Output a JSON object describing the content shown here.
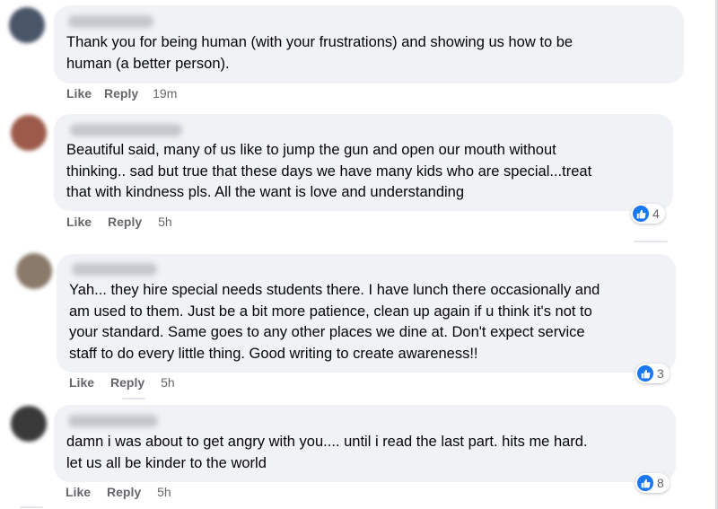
{
  "comments": [
    {
      "author_blurred": true,
      "text": "Thank you for being human (with your frustrations) and showing us how to be\nhuman (a better person).",
      "like_label": "Like",
      "reply_label": "Reply",
      "time": "19m",
      "avatar_color": "#4a5568"
    },
    {
      "author_blurred": true,
      "text": "Beautiful said, many of us like to jump the gun and open our mouth without\nthinking.. sad but true that these days we have many kids who are special...treat\nthat with kindness pls. All the want is love and understanding",
      "like_label": "Like",
      "reply_label": "Reply",
      "time": "5h",
      "reactions": {
        "icon": "like-icon",
        "count": "4"
      },
      "avatar_color": "#9c5a4a"
    },
    {
      "author_blurred": true,
      "text": "Yah... they hire special needs students there. I have lunch there occasionally and\nam used to them. Just be a bit more patience, clean up again if u think it's not to\nyour standard. Same goes to any other places we dine at. Don't expect service\nstaff to do every little thing. Good writing to create awareness!!",
      "like_label": "Like",
      "reply_label": "Reply",
      "time": "5h",
      "reactions": {
        "icon": "like-icon",
        "count": "3"
      },
      "avatar_color": "#8a7a6a"
    },
    {
      "author_blurred": true,
      "text": "damn i was about to get angry with you.... until i read the last part. hits me hard.\nlet us all be kinder to the world",
      "like_label": "Like",
      "reply_label": "Reply",
      "time": "5h",
      "reactions": {
        "icon": "like-icon",
        "count": "8"
      },
      "avatar_color": "#3a3a3a"
    }
  ],
  "colors": {
    "bubble": "#f0f2f5",
    "meta_text": "#65676b",
    "like_blue": "#1877f2"
  }
}
